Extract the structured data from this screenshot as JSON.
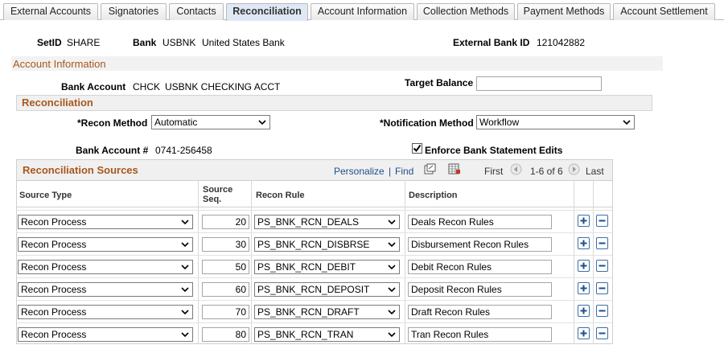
{
  "tabs": [
    {
      "label": "External Accounts",
      "active": false
    },
    {
      "label": "Signatories",
      "active": false
    },
    {
      "label": "Contacts",
      "active": false
    },
    {
      "label": "Reconciliation",
      "active": true
    },
    {
      "label": "Account Information",
      "active": false
    },
    {
      "label": "Collection Methods",
      "active": false
    },
    {
      "label": "Payment Methods",
      "active": false
    },
    {
      "label": "Account Settlement",
      "active": false
    }
  ],
  "header": {
    "setid_label": "SetID",
    "setid_value": "SHARE",
    "bank_label": "Bank",
    "bank_code": "USBNK",
    "bank_name": "United States Bank",
    "ext_id_label": "External Bank ID",
    "ext_id_value": "121042882"
  },
  "account_info": {
    "section_title": "Account Information",
    "bank_account_label": "Bank Account",
    "bank_account_code": "CHCK",
    "bank_account_name": "USBNK CHECKING ACCT",
    "target_balance_label": "Target Balance",
    "target_balance_value": ""
  },
  "reconciliation": {
    "section_title": "Reconciliation",
    "recon_method_label": "*Recon Method",
    "recon_method_value": "Automatic",
    "notification_method_label": "*Notification Method",
    "notification_method_value": "Workflow",
    "bank_account_num_label": "Bank Account #",
    "bank_account_num_value": "0741-256458",
    "enforce_label": "Enforce Bank Statement Edits",
    "enforce_checked": true
  },
  "sources": {
    "title": "Reconciliation Sources",
    "personalize": "Personalize",
    "find": "Find",
    "first": "First",
    "range": "1-6 of 6",
    "last": "Last",
    "col_source_type": "Source Type",
    "col_source_seq_1": "Source",
    "col_source_seq_2": "Seq.",
    "col_recon_rule": "Recon Rule",
    "col_description": "Description",
    "rows": [
      {
        "type": "Recon Process",
        "seq": "20",
        "rule": "PS_BNK_RCN_DEALS",
        "desc": "Deals Recon Rules"
      },
      {
        "type": "Recon Process",
        "seq": "30",
        "rule": "PS_BNK_RCN_DISBRSE",
        "desc": "Disbursement Recon Rules"
      },
      {
        "type": "Recon Process",
        "seq": "50",
        "rule": "PS_BNK_RCN_DEBIT",
        "desc": "Debit Recon Rules"
      },
      {
        "type": "Recon Process",
        "seq": "60",
        "rule": "PS_BNK_RCN_DEPOSIT",
        "desc": "Deposit Recon Rules"
      },
      {
        "type": "Recon Process",
        "seq": "70",
        "rule": "PS_BNK_RCN_DRAFT",
        "desc": "Draft Recon Rules"
      },
      {
        "type": "Recon Process",
        "seq": "80",
        "rule": "PS_BNK_RCN_TRAN",
        "desc": "Tran Recon Rules"
      }
    ]
  },
  "colors": {
    "section_title": "#a8571c",
    "link": "#1f4e8c",
    "active_tab": "#dfe9f5"
  }
}
